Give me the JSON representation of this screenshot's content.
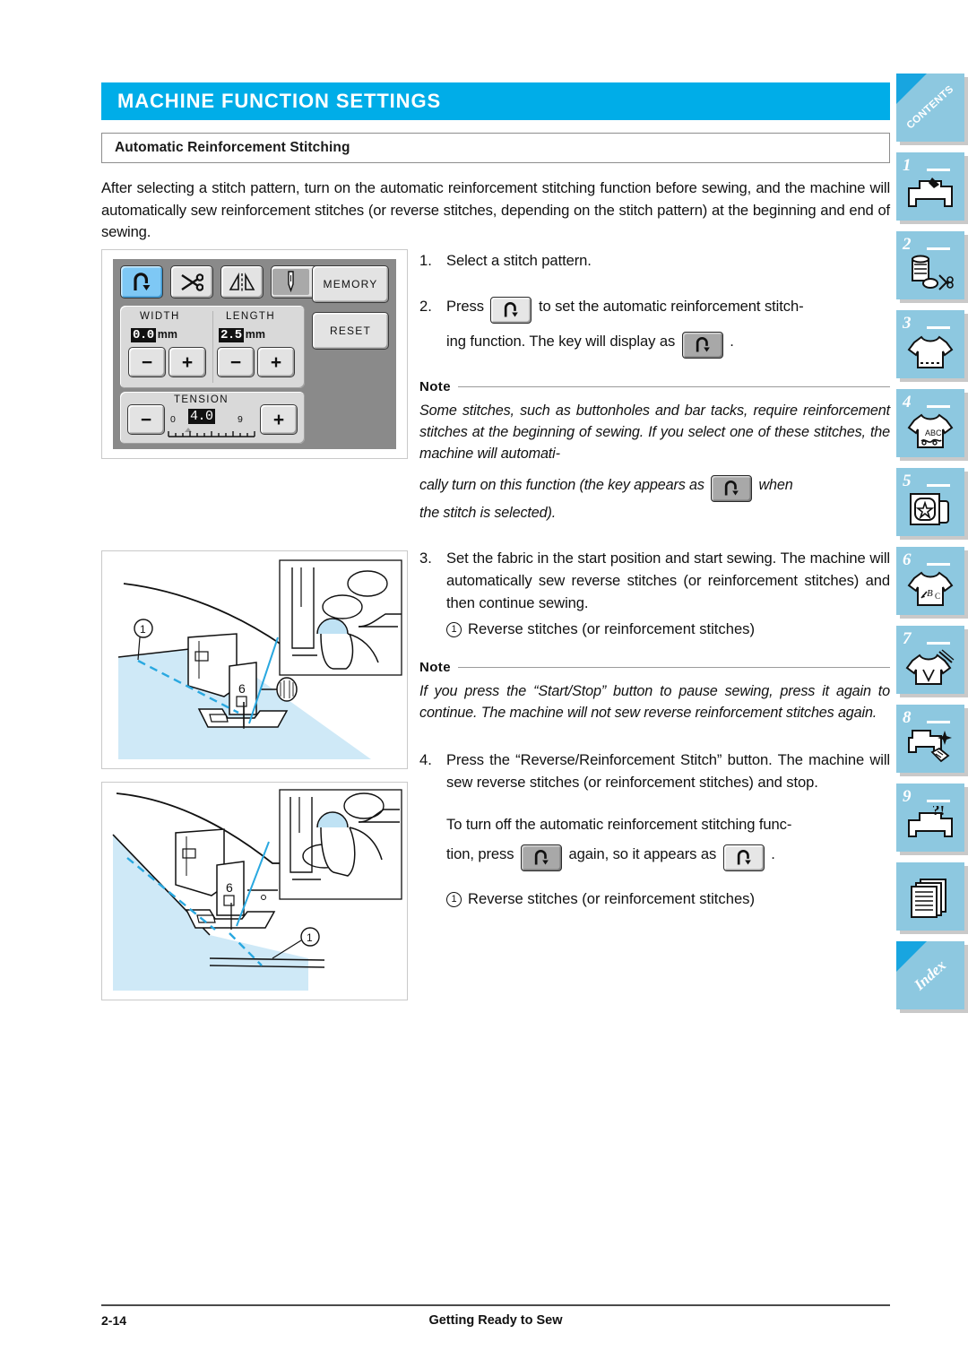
{
  "header": {
    "chapter_title": "MACHINE FUNCTION SETTINGS",
    "section_title": "Automatic Reinforcement Stitching",
    "accent_color": "#00ADE8"
  },
  "intro": "After selecting a stitch pattern, turn on the automatic reinforcement stitching function before sewing, and the machine will automatically sew reinforcement stitches (or reverse stitches, depending on the stitch pattern) at the beginning and end of sewing.",
  "lcd": {
    "top_keys": [
      {
        "name": "reinforcement-stitch-key",
        "state": "selected"
      },
      {
        "name": "thread-cutter-key",
        "state": "normal"
      },
      {
        "name": "mirror-image-key",
        "state": "normal"
      },
      {
        "name": "needle-mode-key",
        "state": "normal"
      }
    ],
    "width": {
      "label": "WIDTH",
      "value": "0.0",
      "unit": "mm",
      "minus": "−",
      "plus": "+"
    },
    "length": {
      "label": "LENGTH",
      "value": "2.5",
      "unit": "mm",
      "minus": "−",
      "plus": "+"
    },
    "tension": {
      "label": "TENSION",
      "value": "4.0",
      "min": "0",
      "max": "9",
      "minus": "−",
      "plus": "+"
    },
    "memory_label": "MEMORY",
    "reset_label": "RESET"
  },
  "steps": {
    "s1_num": "1.",
    "s1_text": "Select a stitch pattern.",
    "s2_num": "2.",
    "s2_a": "Press",
    "s2_b": "to set the automatic reinforcement stitch-",
    "s2_c": "ing function. The key will display as",
    "s2_d": ".",
    "s3_num": "3.",
    "s3_text": "Set the fabric in the start position and start sewing. The machine will automatically sew reverse stitches (or reinforcement stitches) and then continue sewing.",
    "s3_callout_num": "1",
    "s3_callout_text": "Reverse stitches (or reinforcement stitches)",
    "s4_num": "4.",
    "s4_text": "Press the “Reverse/Reinforcement Stitch” button. The machine will sew reverse stitches (or reinforcement stitches) and stop.",
    "s4_p2_a": "To turn off the automatic reinforcement stitching func-",
    "s4_p2_b": "tion, press",
    "s4_p2_c": "again, so it appears as",
    "s4_p2_d": ".",
    "s4_callout_num": "1",
    "s4_callout_text": "Reverse stitches (or reinforcement stitches)"
  },
  "note1": {
    "label": "Note",
    "line1": "Some stitches, such as buttonholes and bar tacks, require reinforcement stitches at the beginning of sewing. If you select one of these stitches, the machine will automati-",
    "line2": "cally turn on this function (the key appears as",
    "line3": "when",
    "line4": "the stitch is selected)."
  },
  "note2": {
    "label": "Note",
    "text": "If you press the “Start/Stop” button to pause sewing, press it again to continue. The machine will not sew reverse reinforcement stitches again."
  },
  "figures": {
    "fig1_callout": "1",
    "fig2_callout": "1",
    "presser_foot_code": "6"
  },
  "side_tabs": [
    {
      "type": "diagonal",
      "label": "CONTENTS",
      "icon": "contents-tab"
    },
    {
      "type": "numbered",
      "number": "1",
      "icon": "sewing-machine-icon"
    },
    {
      "type": "numbered",
      "number": "2",
      "icon": "spool-bobbin-scissors-icon"
    },
    {
      "type": "numbered",
      "number": "3",
      "icon": "tshirt-stitch-icon"
    },
    {
      "type": "numbered",
      "number": "4",
      "icon": "tshirt-abc-icon"
    },
    {
      "type": "numbered",
      "number": "5",
      "icon": "embroidery-frame-star-icon"
    },
    {
      "type": "numbered",
      "number": "6",
      "icon": "tshirt-lettering-icon"
    },
    {
      "type": "numbered",
      "number": "7",
      "icon": "tshirt-needle-icon"
    },
    {
      "type": "numbered",
      "number": "8",
      "icon": "machine-cleaning-icon"
    },
    {
      "type": "numbered",
      "number": "9",
      "icon": "machine-troubleshoot-icon"
    },
    {
      "type": "plain",
      "icon": "documents-icon"
    },
    {
      "type": "diagonal",
      "label": "Index",
      "icon": "index-tab"
    }
  ],
  "footer": {
    "page_number": "2-14",
    "running_title": "Getting Ready to Sew"
  }
}
